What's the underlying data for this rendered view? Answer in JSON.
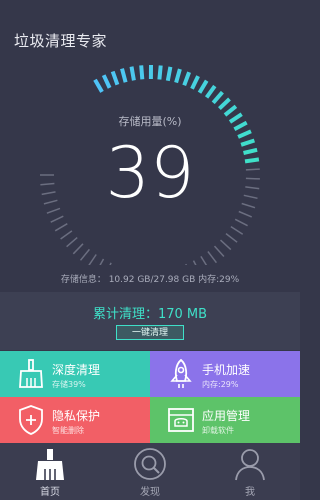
{
  "header": {
    "title": "垃圾清理专家"
  },
  "gauge": {
    "label": "存储用量(%)",
    "value": "39",
    "percent": 39,
    "colors": {
      "active_start": "#4fc3f7",
      "active_end": "#3fe0c8",
      "inactive": "#6b6e80"
    }
  },
  "storage_info": "存储信息： 10.92 GB/27.98 GB  内存:29%",
  "summary": {
    "label": "累计清理：",
    "value": "170 MB",
    "button_label": "一键清理"
  },
  "tiles": [
    {
      "title": "深度清理",
      "subtitle": "存储39%",
      "icon": "broom-icon",
      "color": "#38c9b4"
    },
    {
      "title": "手机加速",
      "subtitle": "内存:29%",
      "icon": "rocket-icon",
      "color": "#8b73ea"
    },
    {
      "title": "隐私保护",
      "subtitle": "智能删除",
      "icon": "shield-icon",
      "color": "#f25f66"
    },
    {
      "title": "应用管理",
      "subtitle": "卸载软件",
      "icon": "app-box-icon",
      "color": "#5dc369"
    }
  ],
  "nav": [
    {
      "label": "首页",
      "icon": "broom-icon",
      "active": true
    },
    {
      "label": "发现",
      "icon": "search-icon",
      "active": false
    },
    {
      "label": "我",
      "icon": "user-icon",
      "active": false
    }
  ]
}
